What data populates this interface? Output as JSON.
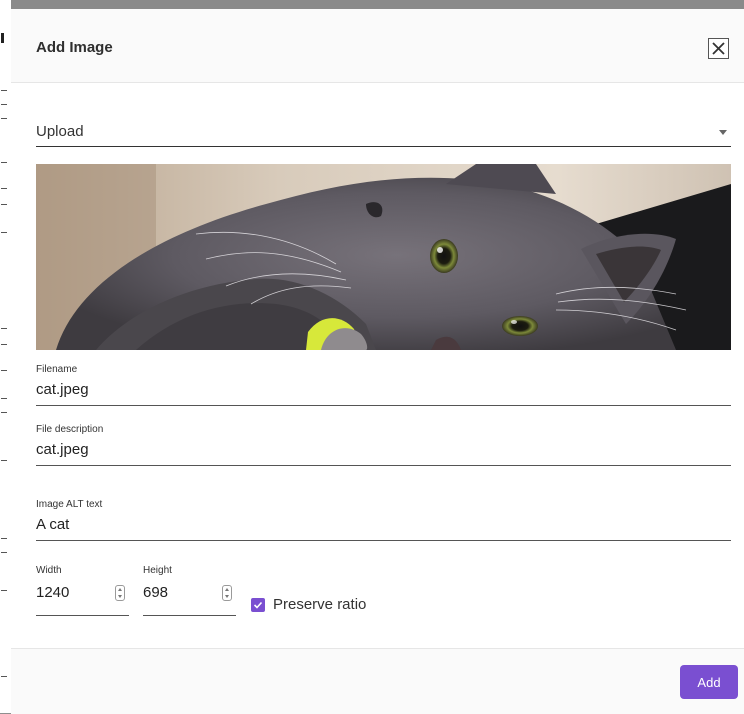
{
  "dialog": {
    "title": "Add Image",
    "close_icon": "close-icon"
  },
  "source_select": {
    "value": "Upload",
    "icon": "chevron-down-icon"
  },
  "preview": {
    "alt": "A cat"
  },
  "fields": {
    "filename": {
      "label": "Filename",
      "value": "cat.jpeg"
    },
    "file_description": {
      "label": "File description",
      "value": "cat.jpeg"
    },
    "alt_text": {
      "label": "Image ALT text",
      "value": "A cat"
    },
    "width": {
      "label": "Width",
      "value": "1240"
    },
    "height": {
      "label": "Height",
      "value": "698"
    },
    "preserve_ratio": {
      "label": "Preserve ratio",
      "checked": true
    }
  },
  "footer": {
    "add_label": "Add"
  },
  "colors": {
    "accent": "#7a4fd1"
  }
}
